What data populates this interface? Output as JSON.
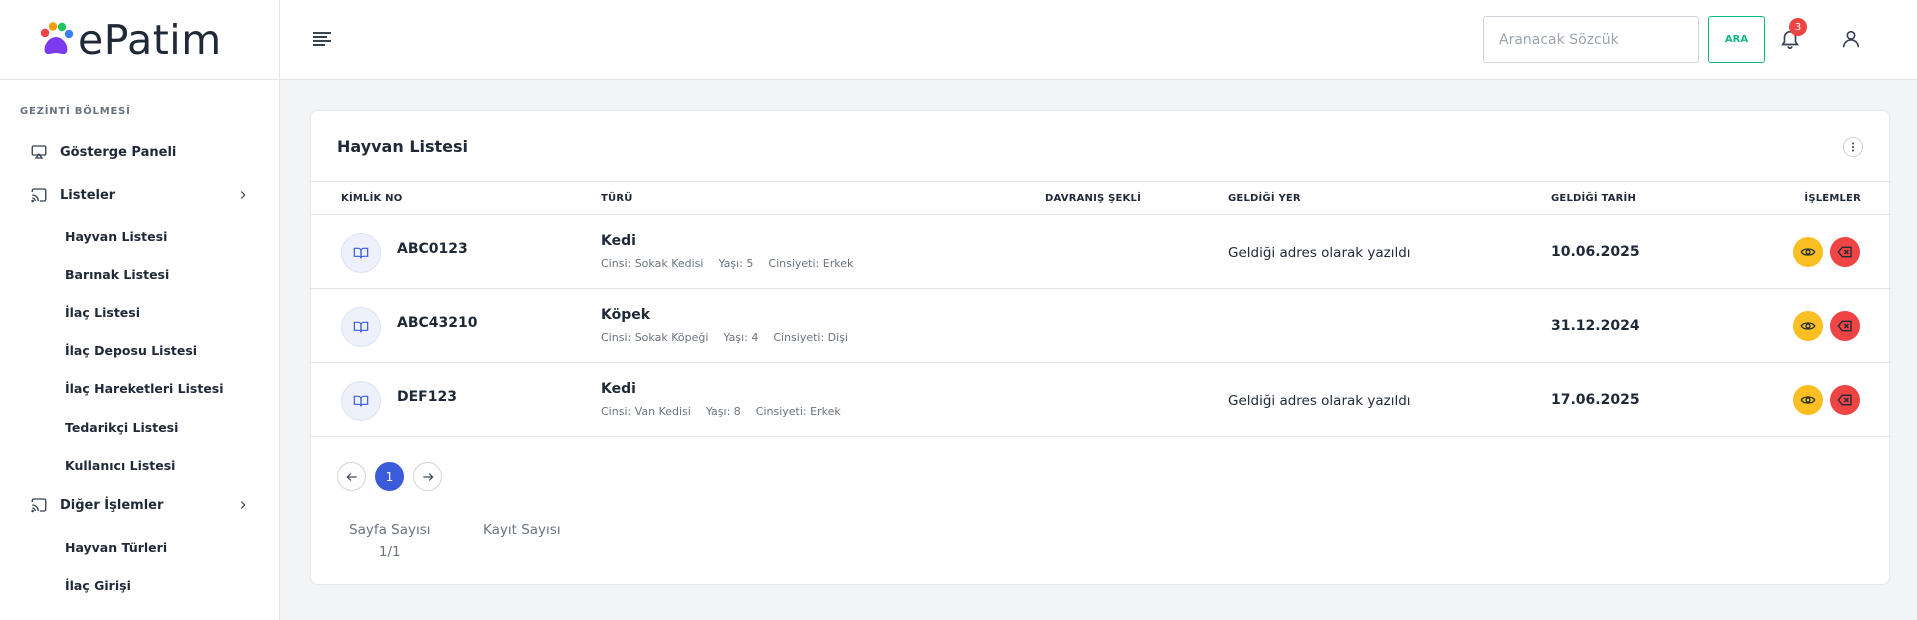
{
  "app": {
    "logo_text": "ePatim"
  },
  "sidebar": {
    "section_title": "GEZİNTİ BÖLMESİ",
    "items": [
      {
        "label": "Gösterge Paneli"
      },
      {
        "label": "Listeler"
      },
      {
        "label": "Diğer İşlemler"
      }
    ],
    "list_subitems": [
      {
        "label": "Hayvan Listesi"
      },
      {
        "label": "Barınak Listesi"
      },
      {
        "label": "İlaç Listesi"
      },
      {
        "label": "İlaç Deposu Listesi"
      },
      {
        "label": "İlaç Hareketleri Listesi"
      },
      {
        "label": "Tedarikçi Listesi"
      },
      {
        "label": "Kullanıcı Listesi"
      }
    ],
    "other_subitems": [
      {
        "label": "Hayvan Türleri"
      },
      {
        "label": "İlaç Girişi"
      }
    ]
  },
  "header": {
    "search_placeholder": "Aranacak Sözcük",
    "search_button": "ARA",
    "notification_count": "3"
  },
  "card": {
    "title": "Hayvan Listesi",
    "columns": [
      "KİMLİK NO",
      "TÜRÜ",
      "DAVRANIŞ ŞEKLİ",
      "GELDİĞİ YER",
      "GELDİĞİ TARİH",
      "İŞLEMLER"
    ],
    "rows": [
      {
        "id": "ABC0123",
        "type": "Kedi",
        "breed": "Cinsi: Sokak Kedisi",
        "age": "Yaşı: 5",
        "gender": "Cinsiyeti: Erkek",
        "place": "Geldiği adres olarak yazıldı",
        "date": "10.06.2025"
      },
      {
        "id": "ABC43210",
        "type": "Köpek",
        "breed": "Cinsi: Sokak Köpeği",
        "age": "Yaşı: 4",
        "gender": "Cinsiyeti: Dişi",
        "place": "",
        "date": "31.12.2024"
      },
      {
        "id": "DEF123",
        "type": "Kedi",
        "breed": "Cinsi: Van Kedisi",
        "age": "Yaşı: 8",
        "gender": "Cinsiyeti: Erkek",
        "place": "Geldiği adres olarak yazıldı",
        "date": "17.06.2025"
      }
    ],
    "pagination": {
      "current_page": "1"
    },
    "footer": {
      "page_count_label": "Sayfa Sayısı",
      "page_count_value": "1/1",
      "record_count_label": "Kayıt Sayısı"
    }
  },
  "colors": {
    "accent": "#3b5bdb",
    "search_btn": "#10b981",
    "view_btn": "#fbbf24",
    "delete_btn": "#ef4444"
  }
}
